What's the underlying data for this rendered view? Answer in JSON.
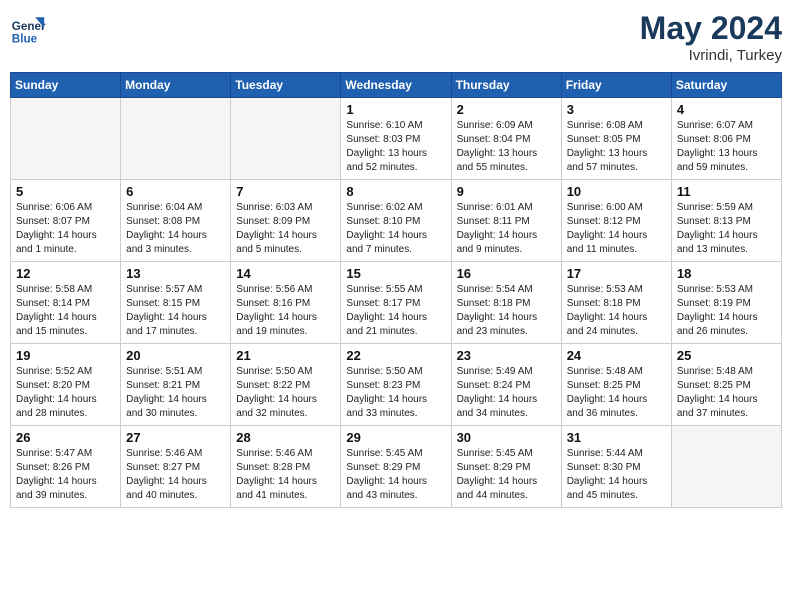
{
  "header": {
    "logo_line1": "General",
    "logo_line2": "Blue",
    "month": "May 2024",
    "location": "Ivrindi, Turkey"
  },
  "days_of_week": [
    "Sunday",
    "Monday",
    "Tuesday",
    "Wednesday",
    "Thursday",
    "Friday",
    "Saturday"
  ],
  "weeks": [
    [
      {
        "day": "",
        "empty": true
      },
      {
        "day": "",
        "empty": true
      },
      {
        "day": "",
        "empty": true
      },
      {
        "day": "1",
        "sunrise": "6:10 AM",
        "sunset": "8:03 PM",
        "daylight": "13 hours and 52 minutes."
      },
      {
        "day": "2",
        "sunrise": "6:09 AM",
        "sunset": "8:04 PM",
        "daylight": "13 hours and 55 minutes."
      },
      {
        "day": "3",
        "sunrise": "6:08 AM",
        "sunset": "8:05 PM",
        "daylight": "13 hours and 57 minutes."
      },
      {
        "day": "4",
        "sunrise": "6:07 AM",
        "sunset": "8:06 PM",
        "daylight": "13 hours and 59 minutes."
      }
    ],
    [
      {
        "day": "5",
        "sunrise": "6:06 AM",
        "sunset": "8:07 PM",
        "daylight": "14 hours and 1 minute."
      },
      {
        "day": "6",
        "sunrise": "6:04 AM",
        "sunset": "8:08 PM",
        "daylight": "14 hours and 3 minutes."
      },
      {
        "day": "7",
        "sunrise": "6:03 AM",
        "sunset": "8:09 PM",
        "daylight": "14 hours and 5 minutes."
      },
      {
        "day": "8",
        "sunrise": "6:02 AM",
        "sunset": "8:10 PM",
        "daylight": "14 hours and 7 minutes."
      },
      {
        "day": "9",
        "sunrise": "6:01 AM",
        "sunset": "8:11 PM",
        "daylight": "14 hours and 9 minutes."
      },
      {
        "day": "10",
        "sunrise": "6:00 AM",
        "sunset": "8:12 PM",
        "daylight": "14 hours and 11 minutes."
      },
      {
        "day": "11",
        "sunrise": "5:59 AM",
        "sunset": "8:13 PM",
        "daylight": "14 hours and 13 minutes."
      }
    ],
    [
      {
        "day": "12",
        "sunrise": "5:58 AM",
        "sunset": "8:14 PM",
        "daylight": "14 hours and 15 minutes."
      },
      {
        "day": "13",
        "sunrise": "5:57 AM",
        "sunset": "8:15 PM",
        "daylight": "14 hours and 17 minutes."
      },
      {
        "day": "14",
        "sunrise": "5:56 AM",
        "sunset": "8:16 PM",
        "daylight": "14 hours and 19 minutes."
      },
      {
        "day": "15",
        "sunrise": "5:55 AM",
        "sunset": "8:17 PM",
        "daylight": "14 hours and 21 minutes."
      },
      {
        "day": "16",
        "sunrise": "5:54 AM",
        "sunset": "8:18 PM",
        "daylight": "14 hours and 23 minutes."
      },
      {
        "day": "17",
        "sunrise": "5:53 AM",
        "sunset": "8:18 PM",
        "daylight": "14 hours and 24 minutes."
      },
      {
        "day": "18",
        "sunrise": "5:53 AM",
        "sunset": "8:19 PM",
        "daylight": "14 hours and 26 minutes."
      }
    ],
    [
      {
        "day": "19",
        "sunrise": "5:52 AM",
        "sunset": "8:20 PM",
        "daylight": "14 hours and 28 minutes."
      },
      {
        "day": "20",
        "sunrise": "5:51 AM",
        "sunset": "8:21 PM",
        "daylight": "14 hours and 30 minutes."
      },
      {
        "day": "21",
        "sunrise": "5:50 AM",
        "sunset": "8:22 PM",
        "daylight": "14 hours and 32 minutes."
      },
      {
        "day": "22",
        "sunrise": "5:50 AM",
        "sunset": "8:23 PM",
        "daylight": "14 hours and 33 minutes."
      },
      {
        "day": "23",
        "sunrise": "5:49 AM",
        "sunset": "8:24 PM",
        "daylight": "14 hours and 34 minutes."
      },
      {
        "day": "24",
        "sunrise": "5:48 AM",
        "sunset": "8:25 PM",
        "daylight": "14 hours and 36 minutes."
      },
      {
        "day": "25",
        "sunrise": "5:48 AM",
        "sunset": "8:25 PM",
        "daylight": "14 hours and 37 minutes."
      }
    ],
    [
      {
        "day": "26",
        "sunrise": "5:47 AM",
        "sunset": "8:26 PM",
        "daylight": "14 hours and 39 minutes."
      },
      {
        "day": "27",
        "sunrise": "5:46 AM",
        "sunset": "8:27 PM",
        "daylight": "14 hours and 40 minutes."
      },
      {
        "day": "28",
        "sunrise": "5:46 AM",
        "sunset": "8:28 PM",
        "daylight": "14 hours and 41 minutes."
      },
      {
        "day": "29",
        "sunrise": "5:45 AM",
        "sunset": "8:29 PM",
        "daylight": "14 hours and 43 minutes."
      },
      {
        "day": "30",
        "sunrise": "5:45 AM",
        "sunset": "8:29 PM",
        "daylight": "14 hours and 44 minutes."
      },
      {
        "day": "31",
        "sunrise": "5:44 AM",
        "sunset": "8:30 PM",
        "daylight": "14 hours and 45 minutes."
      },
      {
        "day": "",
        "empty": true
      }
    ]
  ],
  "labels": {
    "sunrise_prefix": "Sunrise: ",
    "sunset_prefix": "Sunset: ",
    "daylight_prefix": "Daylight: "
  }
}
